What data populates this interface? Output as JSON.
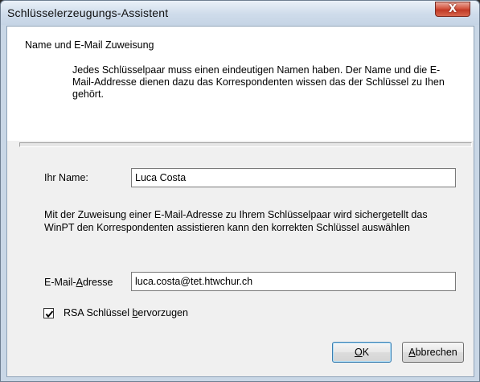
{
  "window": {
    "title": "Schlüsselerzeugungs-Assistent",
    "close_label": "X"
  },
  "header": {
    "section_title": "Name und E-Mail Zuweisung",
    "description": "Jedes Schlüsselpaar muss einen eindeutigen Namen haben. Der Name und die E-Mail-Addresse dienen dazu das Korrespondenten wissen das der Schlüssel zu Ihen gehört."
  },
  "name_field": {
    "label": "Ihr Name:",
    "value": "Luca Costa"
  },
  "info": {
    "text": "Mit der Zuweisung einer E-Mail-Adresse zu Ihrem Schlüsselpaar wird sichergetellt das WinPT den Korrespondenten assistieren kann den korrekten Schlüssel auswählen"
  },
  "email_field": {
    "label_prefix": "E-Mail-",
    "label_accel": "A",
    "label_suffix": "dresse",
    "value": "luca.costa@tet.htwchur.ch"
  },
  "rsa_option": {
    "checked": true,
    "label_prefix": "RSA Schlüssel ",
    "label_accel": "b",
    "label_suffix": "ervorzugen"
  },
  "buttons": {
    "ok_accel": "O",
    "ok_rest": "K",
    "cancel_accel": "A",
    "cancel_rest": "bbrechen"
  }
}
